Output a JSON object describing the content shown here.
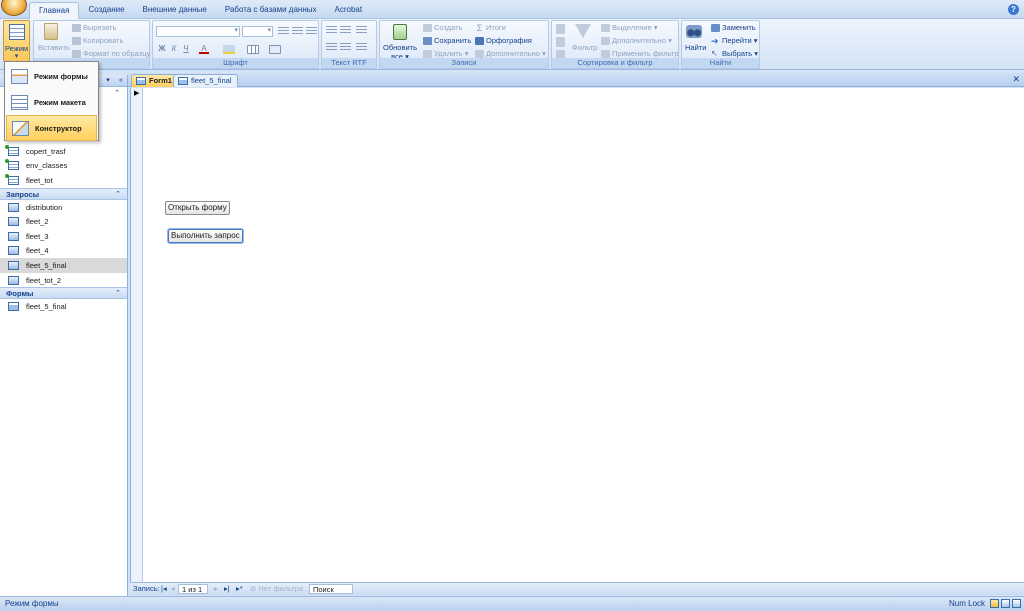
{
  "tabs": [
    "Главная",
    "Создание",
    "Внешние данные",
    "Работа с базами данных",
    "Acrobat"
  ],
  "ribbon": {
    "mode": {
      "label": "Режим"
    },
    "clipboard": {
      "paste": "Вставить",
      "cut": "Вырезать",
      "copy": "Копировать",
      "format_painter": "Формат по образцу",
      "group_label": "ена"
    },
    "font": {
      "bold": "Ж",
      "italic": "К",
      "underline": "Ч",
      "color_a": "A",
      "group_label": "Шрифт"
    },
    "rtf": {
      "group_label": "Текст RTF"
    },
    "records": {
      "refresh": "Обновить",
      "refresh_sub": "все",
      "new": "Создать",
      "save": "Сохранить",
      "delete": "Удалить",
      "totals": "Итоги",
      "spelling": "Орфография",
      "more": "Дополнительно",
      "group_label": "Записи"
    },
    "sort_filter": {
      "filter": "Фильтр",
      "selection": "Выделение",
      "advanced": "Дополнительно",
      "apply": "Применить фильтр",
      "group_label": "Сортировка и фильтр"
    },
    "find": {
      "find": "Найти",
      "replace": "Заменить",
      "goto": "Перейти",
      "select": "Выбрать",
      "group_label": "Найти"
    }
  },
  "mode_menu": [
    {
      "label": "Режим формы",
      "selected": false
    },
    {
      "label": "Режим макета",
      "selected": false
    },
    {
      "label": "Конструктор",
      "selected": true
    }
  ],
  "nav": {
    "tables": [
      "copert_trasf",
      "env_classes",
      "fleet_tot"
    ],
    "queries_header": "Запросы",
    "queries": [
      "distribution",
      "fleet_2",
      "fleet_3",
      "fleet_4",
      "fleet_5_final",
      "fleet_tot_2"
    ],
    "queries_selected": "fleet_5_final",
    "forms_header": "Формы",
    "forms": [
      "fleet_5_final"
    ]
  },
  "doc_tabs": [
    {
      "label": "Form1",
      "active": true
    },
    {
      "label": "fleet_5_final",
      "active": false
    }
  ],
  "form": {
    "open_form_button": "Открыть форму",
    "run_query_button": "Выполнить запрос"
  },
  "record_nav": {
    "label": "Запись:",
    "position": "1 из 1",
    "filter": "Нет фильтра",
    "search": "Поиск"
  },
  "status": {
    "text": "Режим формы",
    "numlock": "Num Lock"
  }
}
